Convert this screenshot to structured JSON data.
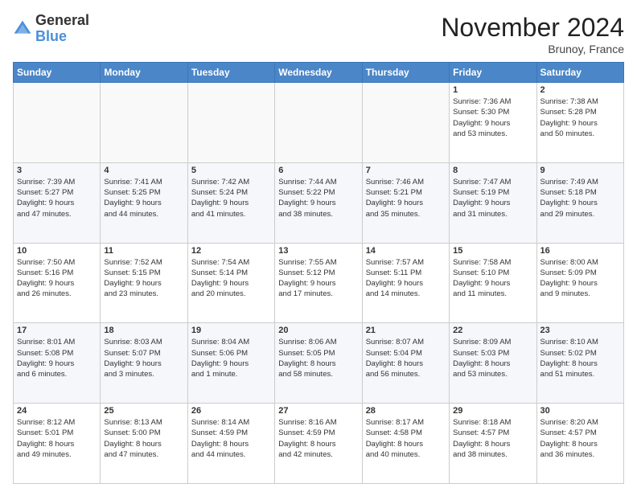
{
  "header": {
    "logo_general": "General",
    "logo_blue": "Blue",
    "month_title": "November 2024",
    "location": "Brunoy, France"
  },
  "weekdays": [
    "Sunday",
    "Monday",
    "Tuesday",
    "Wednesday",
    "Thursday",
    "Friday",
    "Saturday"
  ],
  "weeks": [
    [
      {
        "num": "",
        "info": ""
      },
      {
        "num": "",
        "info": ""
      },
      {
        "num": "",
        "info": ""
      },
      {
        "num": "",
        "info": ""
      },
      {
        "num": "",
        "info": ""
      },
      {
        "num": "1",
        "info": "Sunrise: 7:36 AM\nSunset: 5:30 PM\nDaylight: 9 hours\nand 53 minutes."
      },
      {
        "num": "2",
        "info": "Sunrise: 7:38 AM\nSunset: 5:28 PM\nDaylight: 9 hours\nand 50 minutes."
      }
    ],
    [
      {
        "num": "3",
        "info": "Sunrise: 7:39 AM\nSunset: 5:27 PM\nDaylight: 9 hours\nand 47 minutes."
      },
      {
        "num": "4",
        "info": "Sunrise: 7:41 AM\nSunset: 5:25 PM\nDaylight: 9 hours\nand 44 minutes."
      },
      {
        "num": "5",
        "info": "Sunrise: 7:42 AM\nSunset: 5:24 PM\nDaylight: 9 hours\nand 41 minutes."
      },
      {
        "num": "6",
        "info": "Sunrise: 7:44 AM\nSunset: 5:22 PM\nDaylight: 9 hours\nand 38 minutes."
      },
      {
        "num": "7",
        "info": "Sunrise: 7:46 AM\nSunset: 5:21 PM\nDaylight: 9 hours\nand 35 minutes."
      },
      {
        "num": "8",
        "info": "Sunrise: 7:47 AM\nSunset: 5:19 PM\nDaylight: 9 hours\nand 31 minutes."
      },
      {
        "num": "9",
        "info": "Sunrise: 7:49 AM\nSunset: 5:18 PM\nDaylight: 9 hours\nand 29 minutes."
      }
    ],
    [
      {
        "num": "10",
        "info": "Sunrise: 7:50 AM\nSunset: 5:16 PM\nDaylight: 9 hours\nand 26 minutes."
      },
      {
        "num": "11",
        "info": "Sunrise: 7:52 AM\nSunset: 5:15 PM\nDaylight: 9 hours\nand 23 minutes."
      },
      {
        "num": "12",
        "info": "Sunrise: 7:54 AM\nSunset: 5:14 PM\nDaylight: 9 hours\nand 20 minutes."
      },
      {
        "num": "13",
        "info": "Sunrise: 7:55 AM\nSunset: 5:12 PM\nDaylight: 9 hours\nand 17 minutes."
      },
      {
        "num": "14",
        "info": "Sunrise: 7:57 AM\nSunset: 5:11 PM\nDaylight: 9 hours\nand 14 minutes."
      },
      {
        "num": "15",
        "info": "Sunrise: 7:58 AM\nSunset: 5:10 PM\nDaylight: 9 hours\nand 11 minutes."
      },
      {
        "num": "16",
        "info": "Sunrise: 8:00 AM\nSunset: 5:09 PM\nDaylight: 9 hours\nand 9 minutes."
      }
    ],
    [
      {
        "num": "17",
        "info": "Sunrise: 8:01 AM\nSunset: 5:08 PM\nDaylight: 9 hours\nand 6 minutes."
      },
      {
        "num": "18",
        "info": "Sunrise: 8:03 AM\nSunset: 5:07 PM\nDaylight: 9 hours\nand 3 minutes."
      },
      {
        "num": "19",
        "info": "Sunrise: 8:04 AM\nSunset: 5:06 PM\nDaylight: 9 hours\nand 1 minute."
      },
      {
        "num": "20",
        "info": "Sunrise: 8:06 AM\nSunset: 5:05 PM\nDaylight: 8 hours\nand 58 minutes."
      },
      {
        "num": "21",
        "info": "Sunrise: 8:07 AM\nSunset: 5:04 PM\nDaylight: 8 hours\nand 56 minutes."
      },
      {
        "num": "22",
        "info": "Sunrise: 8:09 AM\nSunset: 5:03 PM\nDaylight: 8 hours\nand 53 minutes."
      },
      {
        "num": "23",
        "info": "Sunrise: 8:10 AM\nSunset: 5:02 PM\nDaylight: 8 hours\nand 51 minutes."
      }
    ],
    [
      {
        "num": "24",
        "info": "Sunrise: 8:12 AM\nSunset: 5:01 PM\nDaylight: 8 hours\nand 49 minutes."
      },
      {
        "num": "25",
        "info": "Sunrise: 8:13 AM\nSunset: 5:00 PM\nDaylight: 8 hours\nand 47 minutes."
      },
      {
        "num": "26",
        "info": "Sunrise: 8:14 AM\nSunset: 4:59 PM\nDaylight: 8 hours\nand 44 minutes."
      },
      {
        "num": "27",
        "info": "Sunrise: 8:16 AM\nSunset: 4:59 PM\nDaylight: 8 hours\nand 42 minutes."
      },
      {
        "num": "28",
        "info": "Sunrise: 8:17 AM\nSunset: 4:58 PM\nDaylight: 8 hours\nand 40 minutes."
      },
      {
        "num": "29",
        "info": "Sunrise: 8:18 AM\nSunset: 4:57 PM\nDaylight: 8 hours\nand 38 minutes."
      },
      {
        "num": "30",
        "info": "Sunrise: 8:20 AM\nSunset: 4:57 PM\nDaylight: 8 hours\nand 36 minutes."
      }
    ]
  ]
}
